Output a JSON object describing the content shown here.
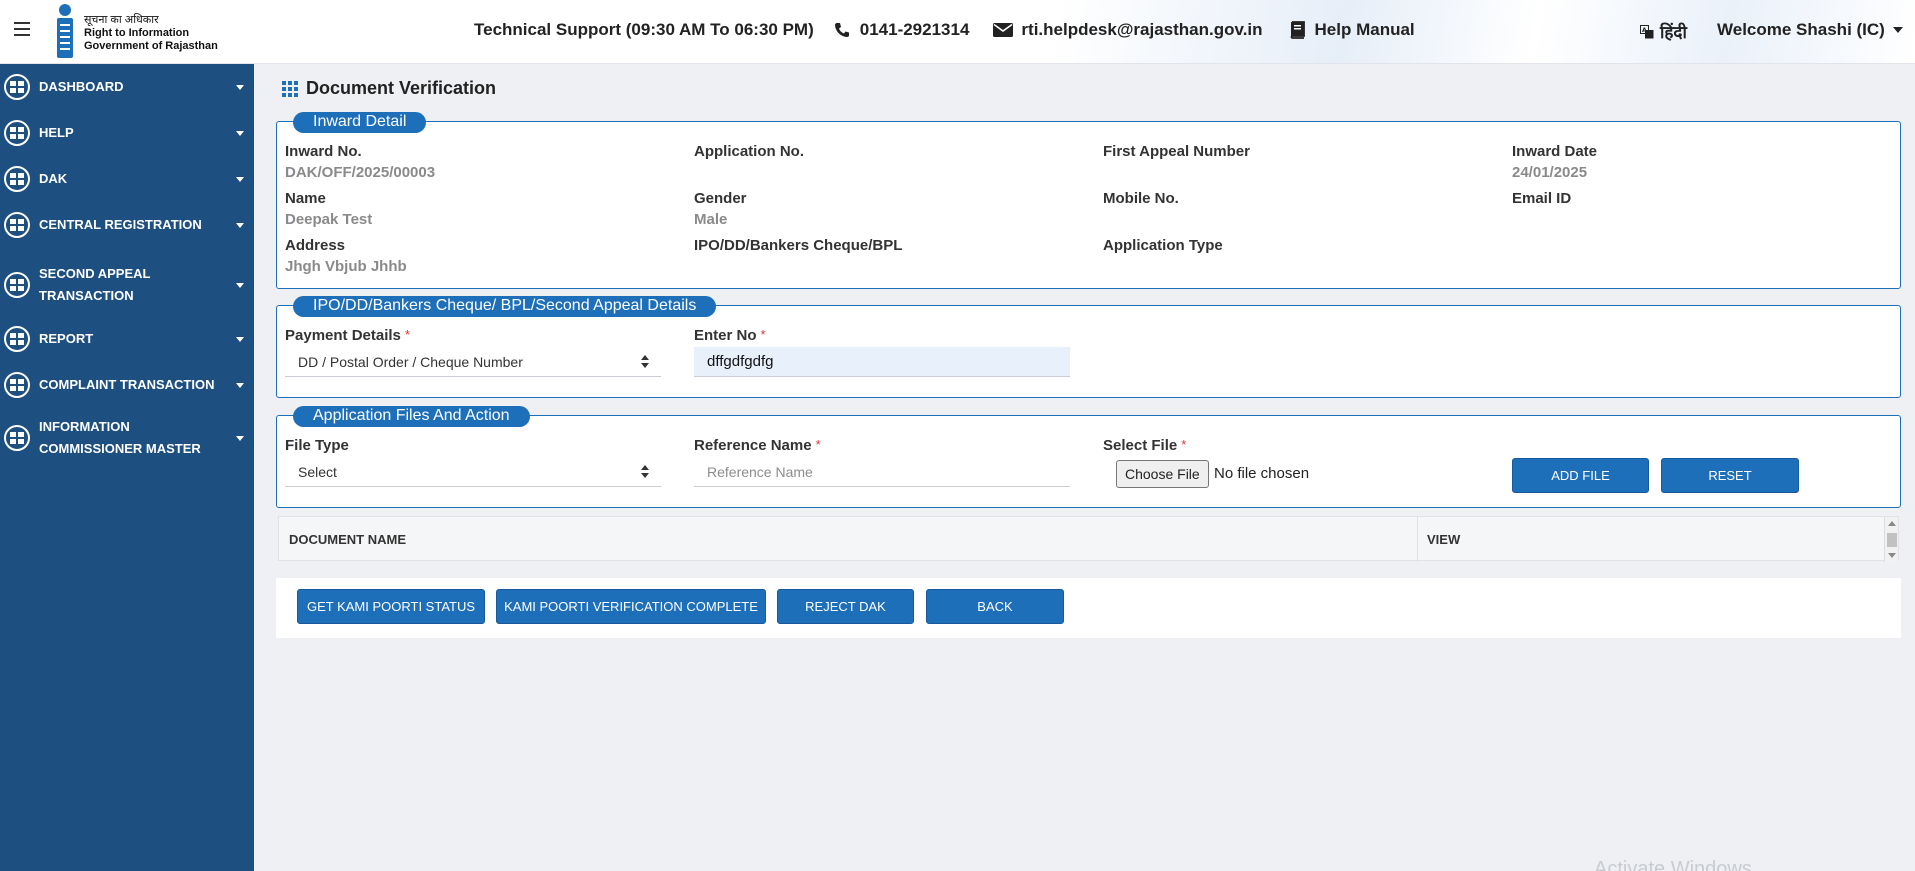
{
  "header": {
    "logo_hindi": "सूचना का अधिकार",
    "logo_line1": "Right to Information",
    "logo_line2": "Government of Rajasthan",
    "support": "Technical Support (09:30 AM To 06:30 PM)",
    "phone": "0141-2921314",
    "email": "rti.helpdesk@rajasthan.gov.in",
    "help_manual": "Help Manual",
    "language": "हिंदी",
    "welcome": "Welcome Shashi (IC)"
  },
  "sidebar": {
    "items": [
      {
        "label": "DASHBOARD"
      },
      {
        "label": "HELP"
      },
      {
        "label": "DAK"
      },
      {
        "label": "CENTRAL REGISTRATION"
      },
      {
        "label": "SECOND APPEAL TRANSACTION"
      },
      {
        "label": "REPORT"
      },
      {
        "label": "COMPLAINT TRANSACTION"
      },
      {
        "label": "INFORMATION COMMISSIONER MASTER"
      }
    ]
  },
  "page": {
    "title": "Document Verification"
  },
  "inward": {
    "legend": "Inward Detail",
    "inward_no_label": "Inward No.",
    "inward_no": "DAK/OFF/2025/00003",
    "application_no_label": "Application No.",
    "application_no": "",
    "first_appeal_label": "First Appeal Number",
    "first_appeal": "",
    "inward_date_label": "Inward Date",
    "inward_date": "24/01/2025",
    "name_label": "Name",
    "name": "Deepak Test",
    "gender_label": "Gender",
    "gender": "Male",
    "mobile_label": "Mobile No.",
    "mobile": "",
    "email_label": "Email ID",
    "email": "",
    "address_label": "Address",
    "address": "Jhgh Vbjub Jhhb",
    "ipo_label": "IPO/DD/Bankers Cheque/BPL",
    "ipo": "",
    "app_type_label": "Application Type",
    "app_type": ""
  },
  "payment": {
    "legend": "IPO/DD/Bankers Cheque/ BPL/Second Appeal Details",
    "payment_label": "Payment Details",
    "payment_value": "DD / Postal Order / Cheque Number",
    "enter_no_label": "Enter No",
    "enter_no_value": "dffgdfgdfg"
  },
  "files": {
    "legend": "Application Files And Action",
    "file_type_label": "File Type",
    "file_type_value": "Select",
    "reference_label": "Reference Name",
    "reference_placeholder": "Reference Name",
    "select_file_label": "Select File",
    "choose_file": "Choose File",
    "no_file": "No file chosen",
    "add_file": "ADD FILE",
    "reset": "RESET"
  },
  "table": {
    "col_document": "DOCUMENT NAME",
    "col_view": "VIEW"
  },
  "actions": {
    "kami_status": "GET KAMI POORTI STATUS",
    "kami_complete": "KAMI POORTI VERIFICATION COMPLETE",
    "reject": "REJECT DAK",
    "back": "BACK"
  },
  "watermark": "Activate Windows",
  "colors": {
    "sidebar": "#1d4f80",
    "accent": "#1e6fb9",
    "required": "#e3342f"
  }
}
